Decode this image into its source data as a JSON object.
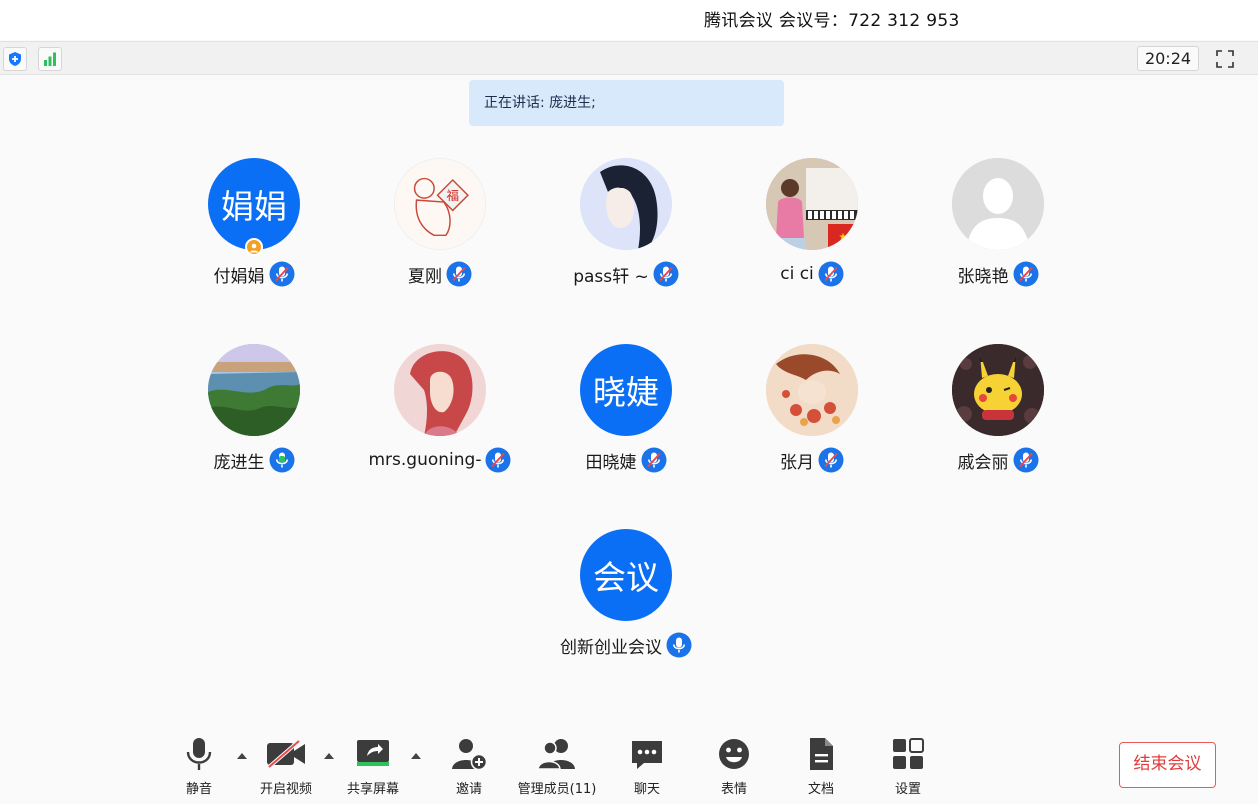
{
  "window": {
    "title": "腾讯会议 会议号：722 312 953"
  },
  "statusbar": {
    "time": "20:24"
  },
  "speaking_banner": "正在讲话: 庞进生;",
  "participants": [
    {
      "name": "付娟娟",
      "avatar_text": "娟娟",
      "is_host": true,
      "mic": "muted"
    },
    {
      "name": "夏刚",
      "avatar_text": "",
      "mic": "muted"
    },
    {
      "name": "pass轩 ~",
      "avatar_text": "",
      "mic": "muted"
    },
    {
      "name": "ci ci",
      "avatar_text": "",
      "mic": "muted"
    },
    {
      "name": "张晓艳",
      "avatar_text": "",
      "mic": "muted"
    },
    {
      "name": "庞进生",
      "avatar_text": "",
      "mic": "speaking"
    },
    {
      "name": "mrs.guoning-",
      "avatar_text": "",
      "mic": "muted"
    },
    {
      "name": "田晓婕",
      "avatar_text": "晓婕",
      "mic": "muted"
    },
    {
      "name": "张月",
      "avatar_text": "",
      "mic": "muted"
    },
    {
      "name": "戚会丽",
      "avatar_text": "",
      "mic": "muted"
    },
    {
      "name": "创新创业会议",
      "avatar_text": "会议",
      "mic": "on"
    }
  ],
  "toolbar": {
    "mute": "静音",
    "video": "开启视频",
    "share": "共享屏幕",
    "invite": "邀请",
    "members": "管理成员(11)",
    "chat": "聊天",
    "emoji": "表情",
    "docs": "文档",
    "settings": "设置"
  },
  "end_meeting": "结束会议",
  "colors": {
    "accent": "#0a6ff5",
    "speaking": "#2fc25b",
    "end": "#e03c3c",
    "banner": "#d9e9fc",
    "toolbar_icon": "#3c3c3c"
  }
}
